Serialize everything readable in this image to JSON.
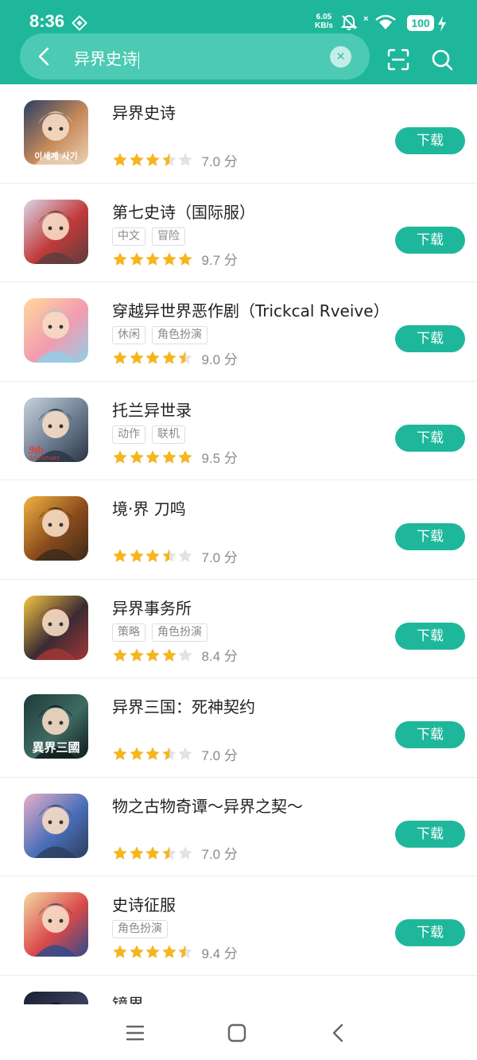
{
  "status": {
    "time": "8:36",
    "net_speed_value": "6.05",
    "net_speed_unit": "KB/s",
    "battery": "100"
  },
  "search": {
    "query": "异界史诗",
    "clear_label": "×"
  },
  "colors": {
    "accent": "#1fb79b",
    "star_filled": "#f7b51c",
    "star_empty": "#e2e2e2"
  },
  "apps": [
    {
      "name": "异界史诗",
      "tags": [],
      "rating": 3.5,
      "score": "7.0 分",
      "button": "下载",
      "icon": "game-icon-yijie-shishi"
    },
    {
      "name": "第七史诗（国际服）",
      "tags": [
        "中文",
        "冒险"
      ],
      "rating": 5,
      "score": "9.7 分",
      "button": "下载",
      "icon": "game-icon-epic-seven"
    },
    {
      "name": "穿越异世界恶作剧（Trickcal Rveive）",
      "tags": [
        "休闲",
        "角色扮演"
      ],
      "rating": 4.5,
      "score": "9.0 分",
      "button": "下载",
      "icon": "game-icon-trickcal"
    },
    {
      "name": "托兰异世录",
      "tags": [
        "动作",
        "联机"
      ],
      "rating": 5,
      "score": "9.5 分",
      "button": "下载",
      "icon": "game-icon-tolan"
    },
    {
      "name": "境·界 刀鸣",
      "tags": [],
      "rating": 3.5,
      "score": "7.0 分",
      "button": "下载",
      "icon": "game-icon-bleach"
    },
    {
      "name": "异界事务所",
      "tags": [
        "策略",
        "角色扮演"
      ],
      "rating": 4,
      "score": "8.4 分",
      "button": "下载",
      "icon": "game-icon-yijie-office"
    },
    {
      "name": "异界三国：死神契约",
      "tags": [],
      "rating": 3.5,
      "score": "7.0 分",
      "button": "下载",
      "icon": "game-icon-three-kingdoms"
    },
    {
      "name": "物之古物奇谭～异界之契～",
      "tags": [],
      "rating": 3.5,
      "score": "7.0 分",
      "button": "下载",
      "icon": "game-icon-antique-tales"
    },
    {
      "name": "史诗征服",
      "tags": [
        "角色扮演"
      ],
      "rating": 4.5,
      "score": "9.4 分",
      "button": "下载",
      "icon": "game-icon-epic-conquest"
    },
    {
      "name": "镜界",
      "tags": [],
      "rating": 0,
      "score": "",
      "button": "",
      "icon": "game-icon-jingjie"
    }
  ],
  "icon_text": {
    "yijie": "이세계 사기",
    "anniv_num": "9th",
    "anniv_word": "Anniversary",
    "three_kingdoms": "異界三國"
  }
}
